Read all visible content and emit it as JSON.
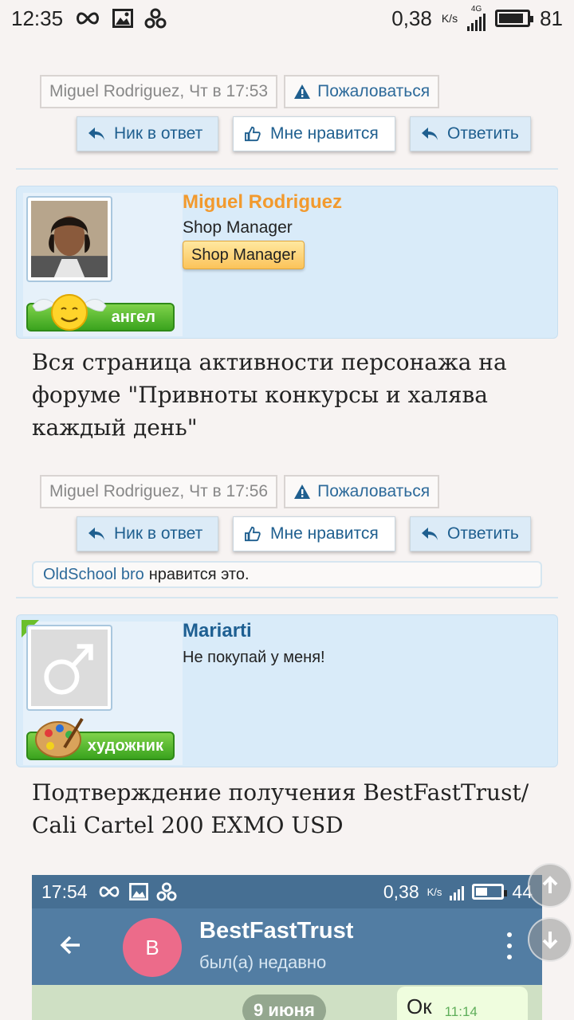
{
  "status_bar": {
    "time": "12:35",
    "speed": "0,38",
    "speed_unit": "K/s",
    "net": "4G",
    "battery": "81"
  },
  "posts": [
    {
      "author": "Miguel Rodriguez",
      "date": "Чт в 17:53",
      "report": "Пожаловаться",
      "actions": {
        "quote": "Ник в ответ",
        "like": "Мне нравится",
        "reply": "Ответить"
      }
    },
    {
      "author": "Miguel Rodriguez",
      "author_color": "#f29a2e",
      "user_title": "Shop Manager",
      "role_badge": "Shop Manager",
      "rank": "ангел",
      "body": "Вся страница активности персонажа на форуме \"Привноты конкурсы и халява каждый день\"",
      "date": "Чт в 17:56",
      "report": "Пожаловаться",
      "actions": {
        "quote": "Ник в ответ",
        "like": "Мне нравится",
        "reply": "Ответить"
      },
      "likes": {
        "liker": "OldSchool bro",
        "text": "нравится это."
      }
    },
    {
      "author": "Mariarti",
      "author_color": "#1e5f92",
      "user_title": "Не покупай у меня!",
      "rank": "художник",
      "body": "Подтверждение получения BestFastTrust/ Cali Cartel 200 EXMO USD"
    }
  ],
  "embed": {
    "time": "17:54",
    "speed": "0,38",
    "speed_unit": "K/s",
    "battery": "44",
    "avatar_letter": "B",
    "chat_name": "BestFastTrust",
    "chat_status": "был(а) недавно",
    "date_pill": "9 июня",
    "message": "Ок",
    "message_time": "11:14"
  },
  "colors": {
    "link": "#2d6a9a",
    "accent": "#d9ebf9"
  }
}
